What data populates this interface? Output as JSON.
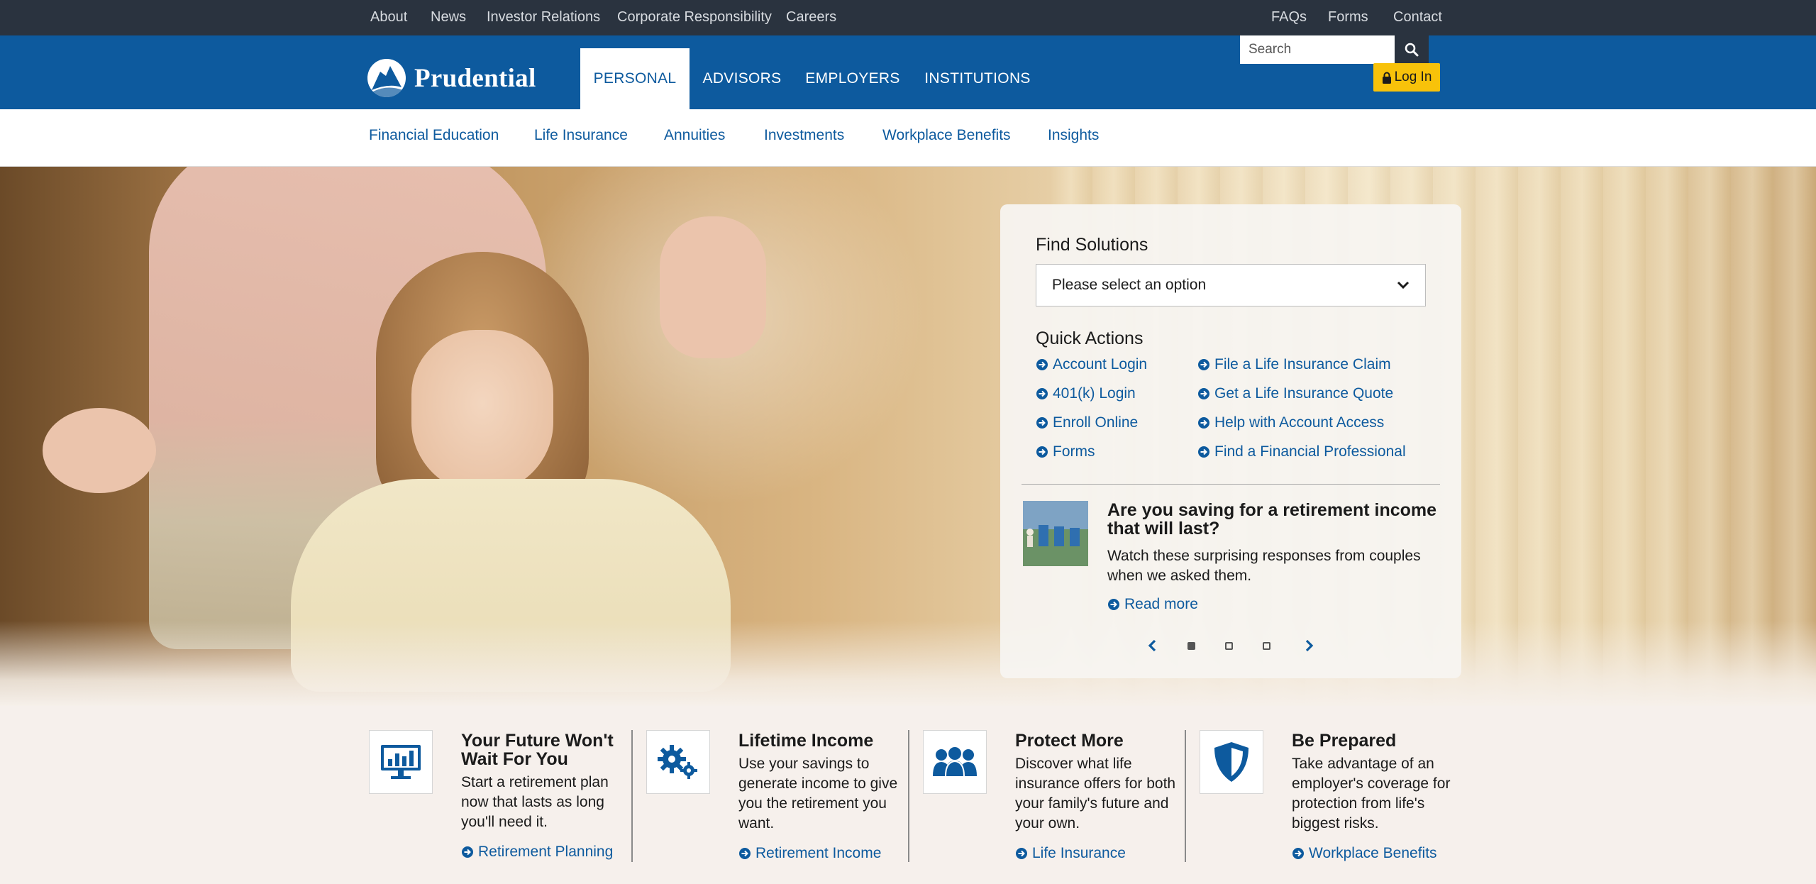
{
  "utility_nav": {
    "left": [
      "About",
      "News",
      "Investor Relations",
      "Corporate Responsibility",
      "Careers"
    ],
    "right": [
      "FAQs",
      "Forms",
      "Contact"
    ]
  },
  "brand": {
    "name": "Prudential"
  },
  "main_nav": {
    "tabs": [
      "PERSONAL",
      "ADVISORS",
      "EMPLOYERS",
      "INSTITUTIONS"
    ],
    "active": "PERSONAL"
  },
  "search": {
    "placeholder": "Search",
    "icon": "search-icon"
  },
  "login": {
    "label": "Log In",
    "icon": "lock-icon"
  },
  "sub_nav": [
    "Financial Education",
    "Life Insurance",
    "Annuities",
    "Investments",
    "Workplace Benefits",
    "Insights"
  ],
  "find_solutions": {
    "title": "Find Solutions",
    "select_value": "Please select an option"
  },
  "quick_actions": {
    "title": "Quick Actions",
    "left": [
      "Account Login",
      "401(k) Login",
      "Enroll Online",
      "Forms"
    ],
    "right": [
      "File a Life Insurance Claim",
      "Get a Life Insurance Quote",
      "Help with Account Access",
      "Find a Financial Professional"
    ]
  },
  "promo": {
    "title": "Are you saving for a retirement income that will last?",
    "text": "Watch these surprising responses from couples when we asked them.",
    "link": "Read more"
  },
  "carousel": {
    "slides": 3,
    "current": 1
  },
  "features": [
    {
      "icon": "chart-monitor-icon",
      "title": "Your Future Won't Wait For You",
      "text": "Start a retirement plan now that lasts as long you'll need it.",
      "link": "Retirement Planning"
    },
    {
      "icon": "gears-icon",
      "title": "Lifetime Income",
      "text": "Use your savings to generate income to give you the retirement you want.",
      "link": "Retirement Income"
    },
    {
      "icon": "people-icon",
      "title": "Protect More",
      "text": "Discover what life insurance offers for both your family's future and your own.",
      "link": "Life Insurance"
    },
    {
      "icon": "shield-icon",
      "title": "Be Prepared",
      "text": "Take advantage of an employer's coverage for protection from life's biggest risks.",
      "link": "Workplace Benefits"
    }
  ],
  "colors": {
    "utility_bar": "#2a333f",
    "brand_blue": "#0d5a9e",
    "login_yellow": "#f8c20a"
  }
}
